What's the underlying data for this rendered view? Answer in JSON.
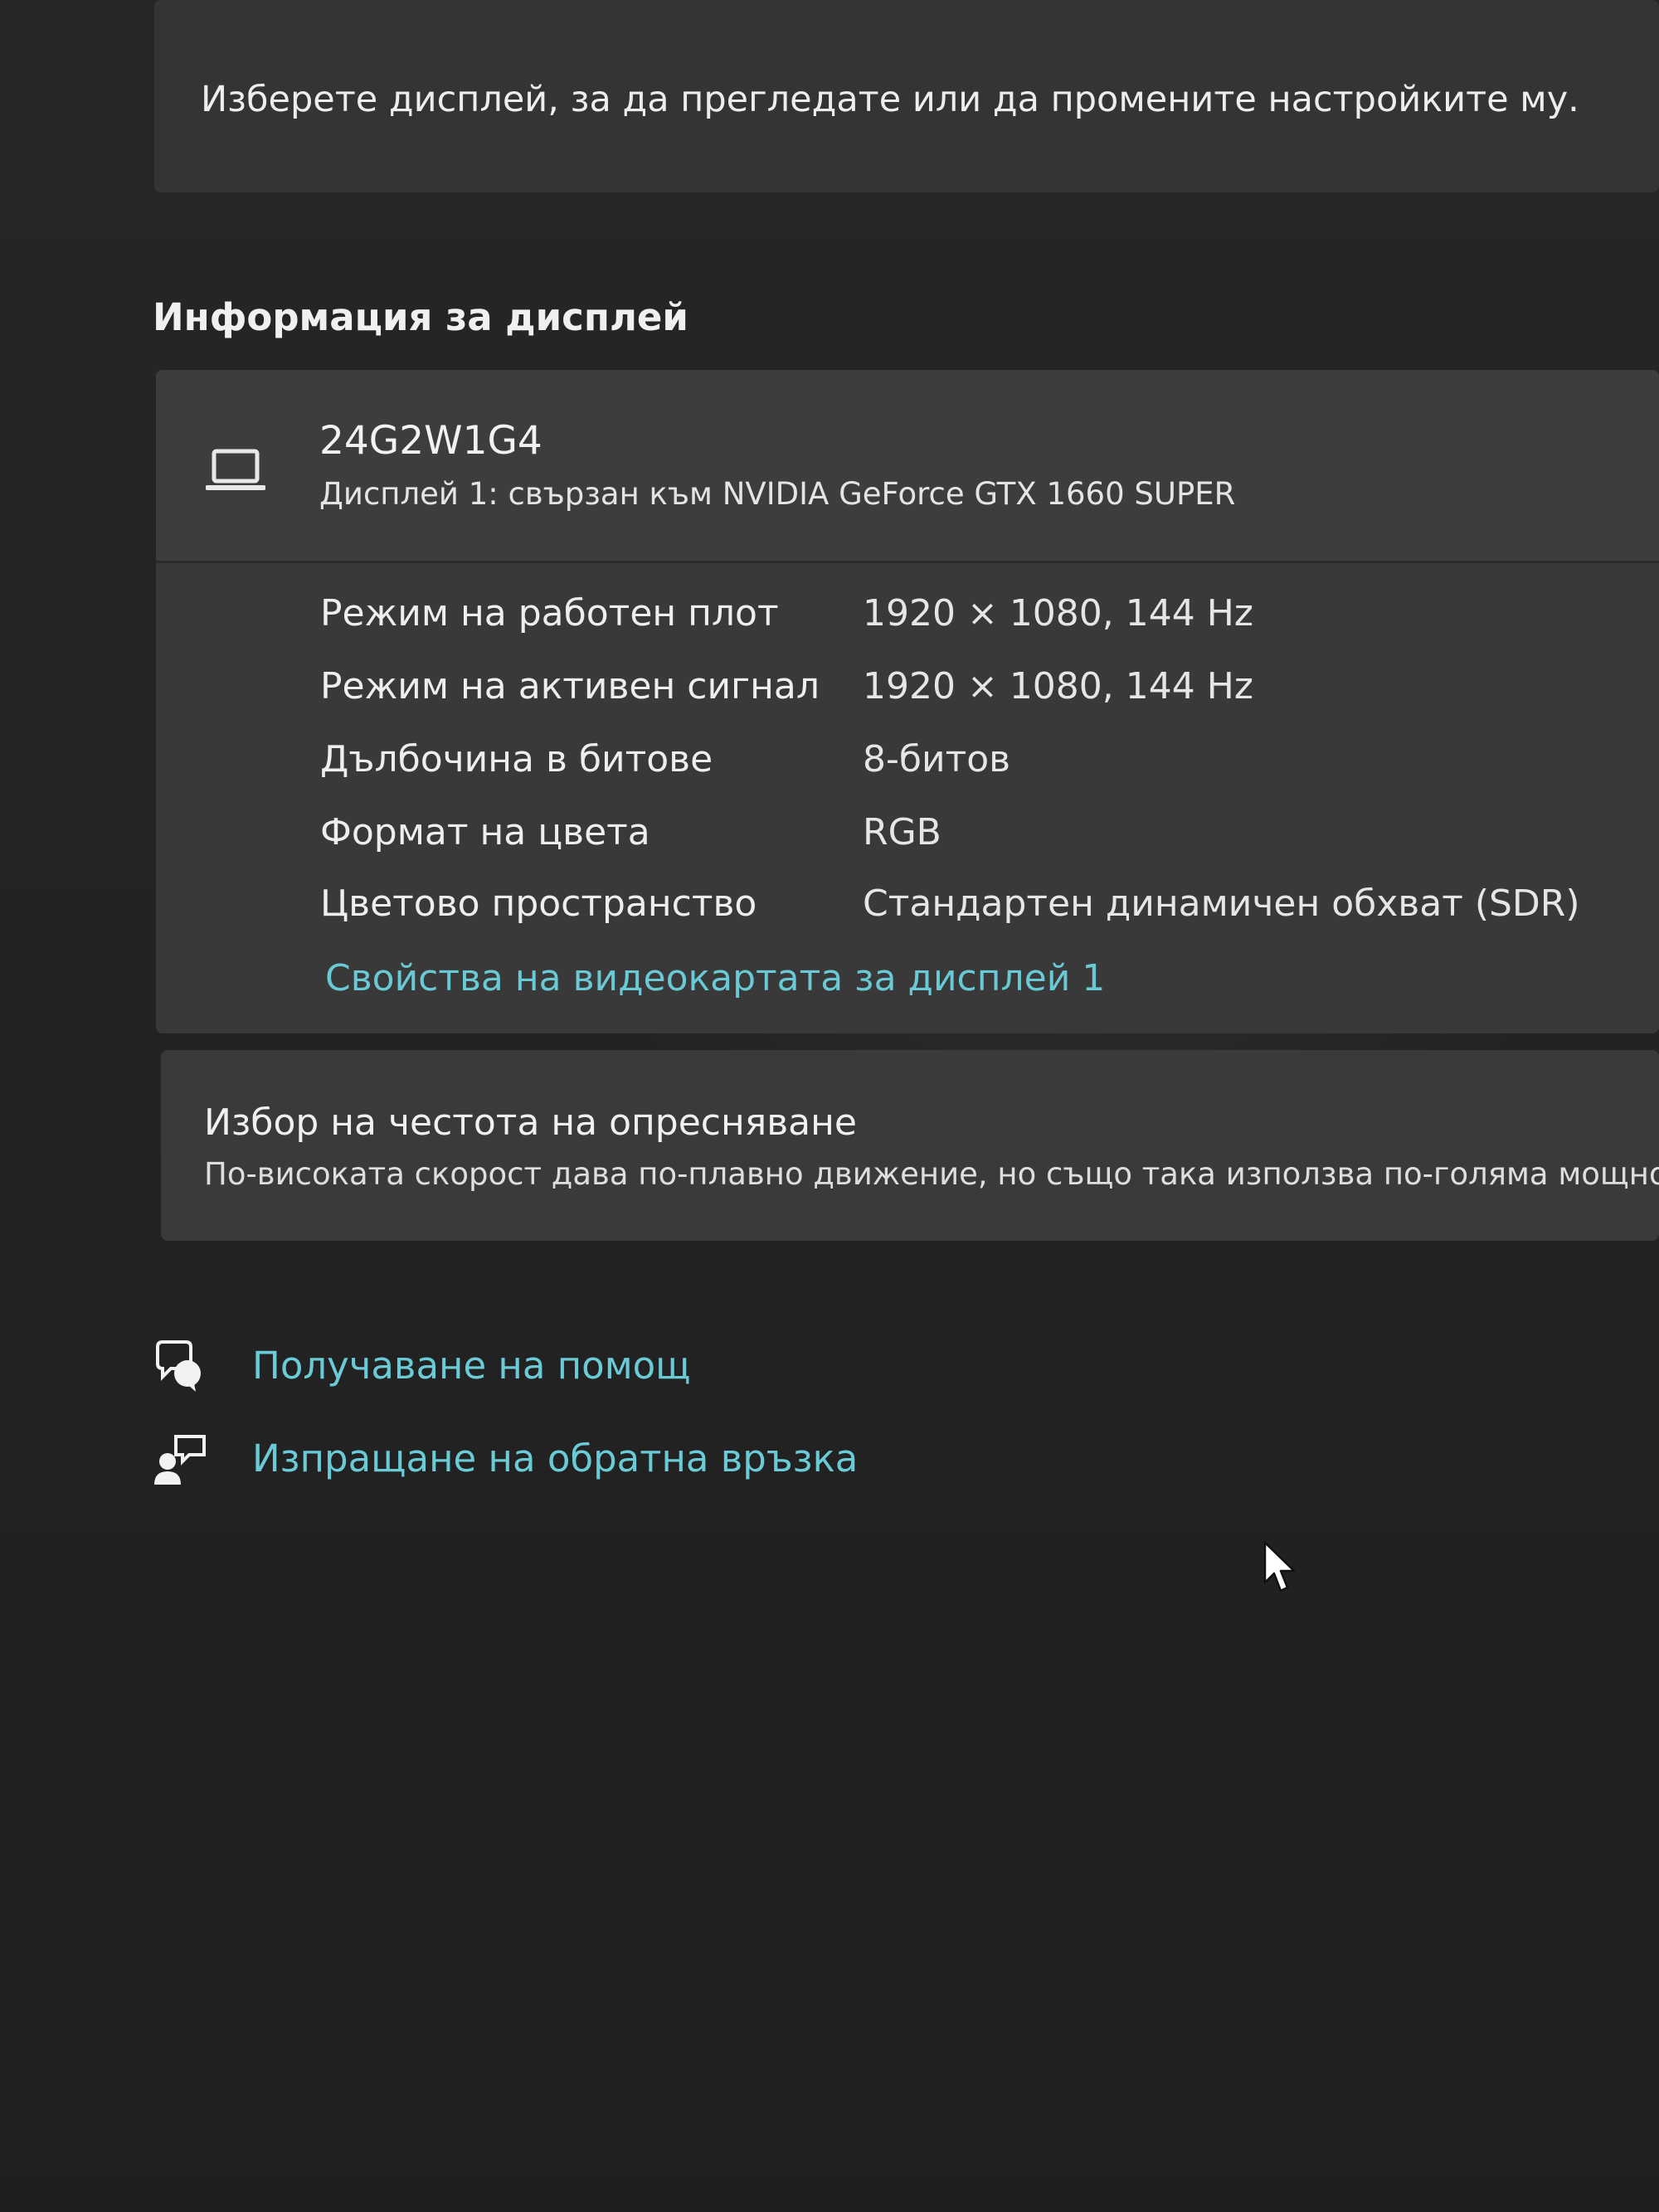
{
  "select_display": {
    "prompt": "Изберете дисплей, за да прегледате или да промените настройките му."
  },
  "display_info": {
    "heading": "Информация за дисплей",
    "monitor_icon": "laptop-monitor-icon",
    "display_name": "24G2W1G4",
    "connection": "Дисплей 1: свързан към NVIDIA GeForce GTX 1660 SUPER",
    "properties": [
      {
        "label": "Режим на работен плот",
        "value": "1920 × 1080, 144 Hz"
      },
      {
        "label": "Режим на активен сигнал",
        "value": "1920 × 1080, 144 Hz"
      },
      {
        "label": "Дълбочина в битове",
        "value": "8-битов"
      },
      {
        "label": "Формат на цвета",
        "value": "RGB"
      },
      {
        "label": "Цветово пространство",
        "value": "Стандартен динамичен обхват (SDR)"
      }
    ],
    "adapter_link": "Свойства на видеокартата за дисплей 1"
  },
  "refresh_rate": {
    "title": "Избор на честота на опресняване",
    "description": "По-високата скорост дава по-плавно движение, но също така използва по-голяма мощно"
  },
  "help_links": [
    {
      "label": "Получаване на помощ",
      "icon": "help-chat-icon"
    },
    {
      "label": "Изпращане на обратна връзка",
      "icon": "feedback-icon"
    }
  ],
  "colors": {
    "background": "#272626",
    "card": "#3a3939",
    "link_accent": "#69c9d4"
  }
}
